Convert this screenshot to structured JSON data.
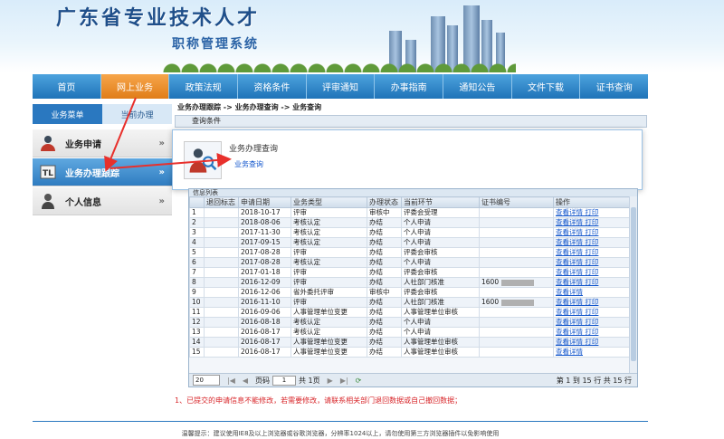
{
  "banner": {
    "title": "广东省专业技术人才",
    "subtitle": "职称管理系统"
  },
  "nav": {
    "items": [
      "首页",
      "网上业务",
      "政策法规",
      "资格条件",
      "评审通知",
      "办事指南",
      "通知公告",
      "文件下载",
      "证书查询"
    ],
    "active_index": 1
  },
  "sidebar": {
    "tabs": [
      "业务菜单",
      "当前办理"
    ],
    "items": [
      {
        "label": "业务申请",
        "arrow": "»"
      },
      {
        "label": "业务办理跟踪",
        "arrow": "»"
      },
      {
        "label": "个人信息",
        "arrow": "»"
      }
    ]
  },
  "main": {
    "breadcrumb": "业务办理跟踪 -> 业务办理查询 -> 业务查询",
    "query_section": "查询条件"
  },
  "popup": {
    "title": "业务办理查询",
    "link": "业务查询"
  },
  "grid": {
    "caption": "信息列表",
    "columns": [
      "",
      "退回标志",
      "申请日期",
      "业务类型",
      "办理状态",
      "当前环节",
      "证书编号",
      "操作"
    ],
    "view_label": "查看详情",
    "print_label": "打印",
    "rows": [
      {
        "no": "1",
        "date": "2018-10-17",
        "type": "评审",
        "status": "审核中",
        "step": "评委会受理",
        "cert": "",
        "print": true
      },
      {
        "no": "2",
        "date": "2018-08-06",
        "type": "考核认定",
        "status": "办结",
        "step": "个人申请",
        "cert": "",
        "print": true
      },
      {
        "no": "3",
        "date": "2017-11-30",
        "type": "考核认定",
        "status": "办结",
        "step": "个人申请",
        "cert": "",
        "print": true
      },
      {
        "no": "4",
        "date": "2017-09-15",
        "type": "考核认定",
        "status": "办结",
        "step": "个人申请",
        "cert": "",
        "print": true
      },
      {
        "no": "5",
        "date": "2017-08-28",
        "type": "评审",
        "status": "办结",
        "step": "评委会审核",
        "cert": "",
        "print": true
      },
      {
        "no": "6",
        "date": "2017-08-28",
        "type": "考核认定",
        "status": "办结",
        "step": "个人申请",
        "cert": "",
        "print": true
      },
      {
        "no": "7",
        "date": "2017-01-18",
        "type": "评审",
        "status": "办结",
        "step": "评委会审核",
        "cert": "",
        "print": true
      },
      {
        "no": "8",
        "date": "2016-12-09",
        "type": "评审",
        "status": "办结",
        "step": "人社部门核准",
        "cert": "1600",
        "print": true
      },
      {
        "no": "9",
        "date": "2016-12-06",
        "type": "省外委托评审",
        "status": "审核中",
        "step": "评委会审核",
        "cert": "",
        "print": false
      },
      {
        "no": "10",
        "date": "2016-11-10",
        "type": "评审",
        "status": "办结",
        "step": "人社部门核准",
        "cert": "1600",
        "print": true
      },
      {
        "no": "11",
        "date": "2016-09-06",
        "type": "人事管理单位变更",
        "status": "办结",
        "step": "人事管理单位审核",
        "cert": "",
        "print": true
      },
      {
        "no": "12",
        "date": "2016-08-18",
        "type": "考核认定",
        "status": "办结",
        "step": "个人申请",
        "cert": "",
        "print": true
      },
      {
        "no": "13",
        "date": "2016-08-17",
        "type": "考核认定",
        "status": "办结",
        "step": "个人申请",
        "cert": "",
        "print": true
      },
      {
        "no": "14",
        "date": "2016-08-17",
        "type": "人事管理单位变更",
        "status": "办结",
        "step": "人事管理单位审核",
        "cert": "",
        "print": true
      },
      {
        "no": "15",
        "date": "2016-08-17",
        "type": "人事管理单位变更",
        "status": "办结",
        "step": "人事管理单位审核",
        "cert": "",
        "print": false
      }
    ]
  },
  "pager": {
    "page_size": "20",
    "page_label": "页码",
    "page_value": "1",
    "page_total": "共 1页",
    "summary": "第 1 到 15 行 共 15 行"
  },
  "note": "1、已提交的申请信息不能修改，若需要修改，请联系相关部门退回数据或自己撤回数据；",
  "footer": "温馨提示：建议使用IE8及以上浏览器或谷歌浏览器，分辨率1024以上，请勿使用第三方浏览器插件以免影响使用",
  "colors": {
    "nav": "#2a78c0",
    "nav_active": "#e88a25",
    "annotation": "#e8302c",
    "link": "#1155cc"
  }
}
